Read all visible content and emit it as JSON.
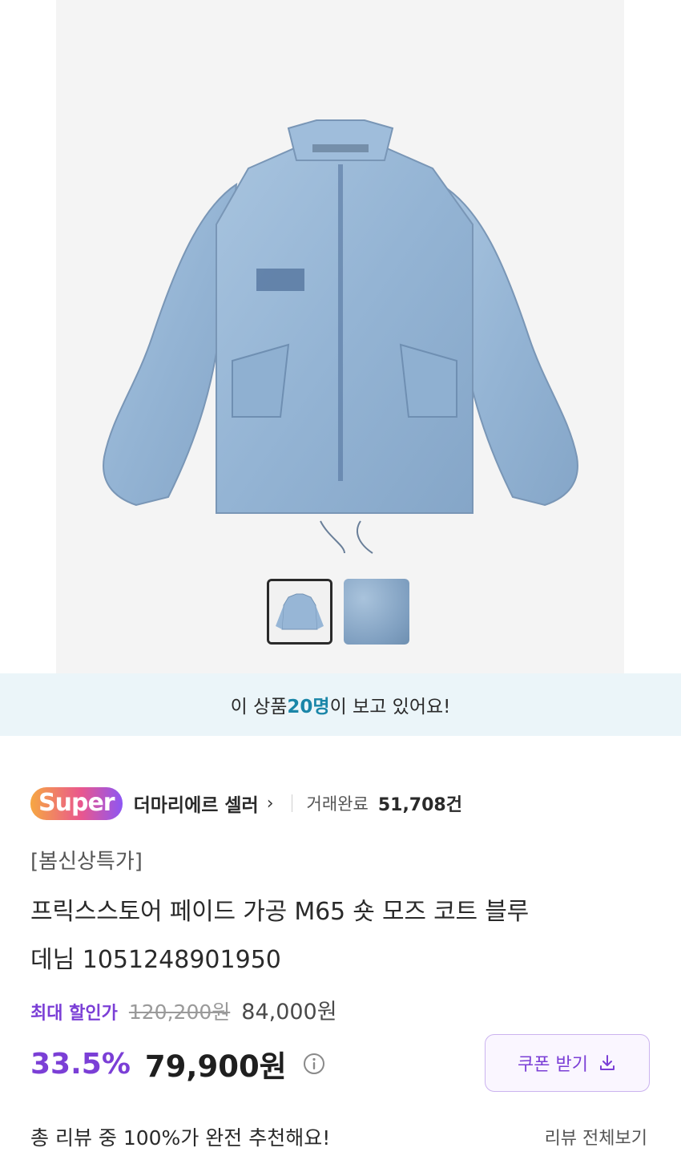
{
  "product": {
    "thumbnails": [
      {
        "name": "jacket-front"
      },
      {
        "name": "fabric-closeup"
      }
    ]
  },
  "viewers": {
    "prefix": "이 상품 ",
    "count": "20명",
    "suffix": "이 보고 있어요!"
  },
  "seller": {
    "badge": "Super",
    "name": "더마리에르 셀러",
    "chevron": "›",
    "trade_label": "거래완료",
    "trade_count": "51,708건"
  },
  "item": {
    "tag": "[봄신상특가]",
    "title_line1": "프릭스스토어 페이드 가공 M65 숏 모즈 코트 블루",
    "title_line2": "데님 1051248901950"
  },
  "pricing": {
    "discount_label": "최대 할인가",
    "original_price": "120,200원",
    "sale_price": "84,000원",
    "discount_percent": "33.5%",
    "final_price": "79,900원"
  },
  "coupon": {
    "label": "쿠폰 받기",
    "icon": "download-icon"
  },
  "reviews": {
    "summary": "총 리뷰 중 100%가 완전 추천해요!",
    "view_all": "리뷰 전체보기"
  },
  "colors": {
    "accent": "#7b3fd6",
    "viewer_highlight": "#1a86a8",
    "viewer_banner_bg": "#ebf5f9"
  }
}
